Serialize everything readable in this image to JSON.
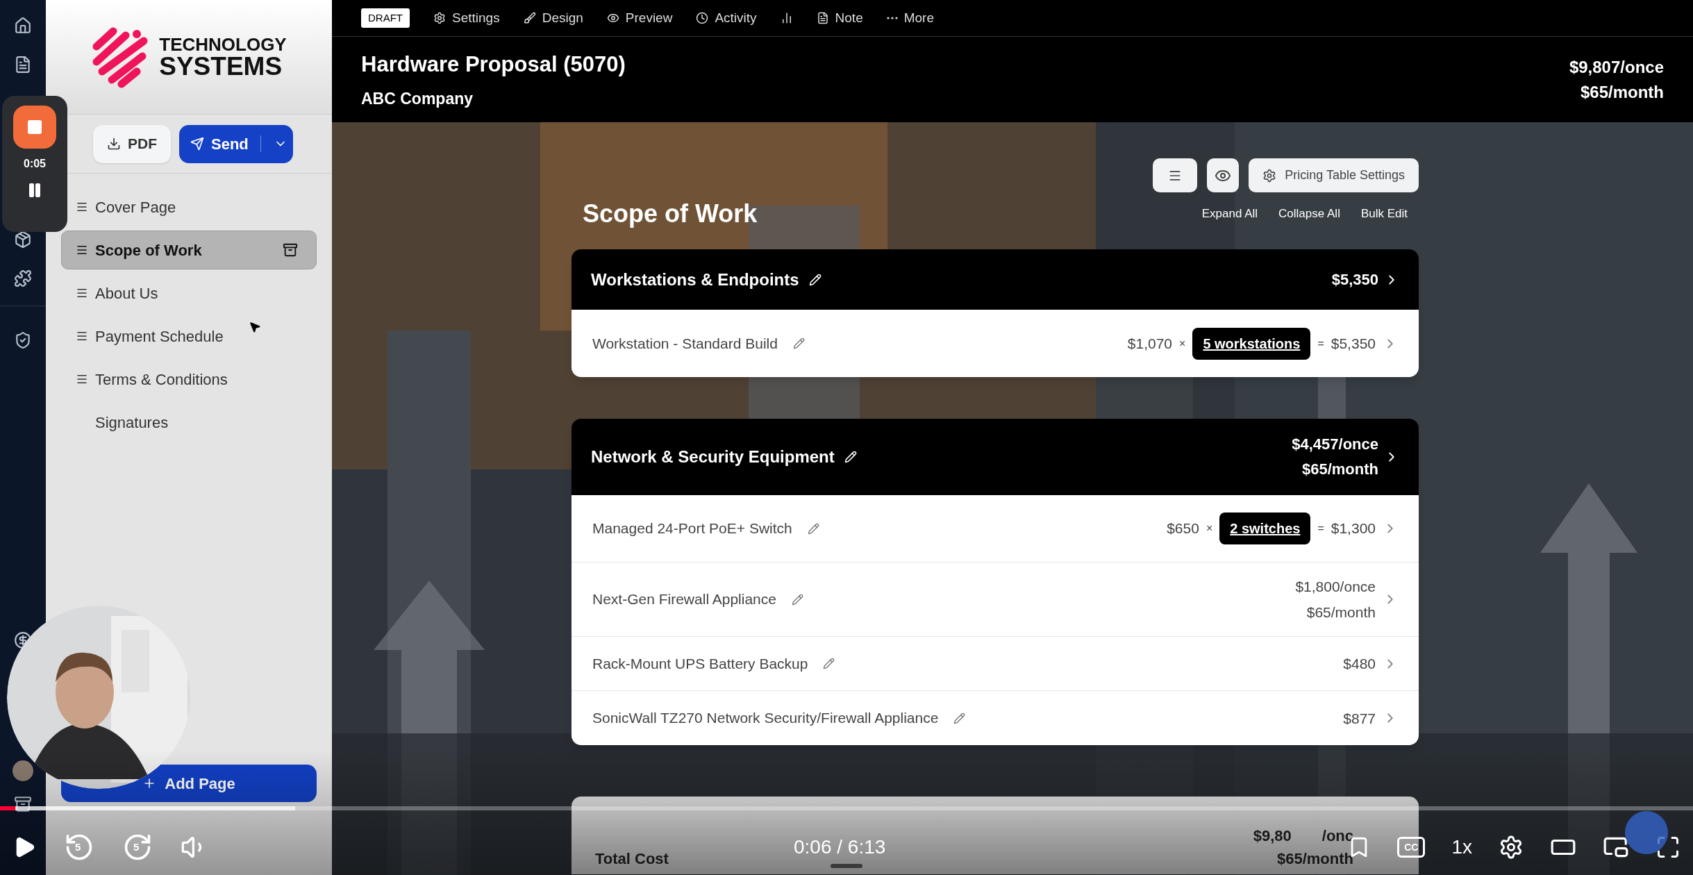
{
  "recorder": {
    "time": "0:05"
  },
  "sidebar": {
    "logo": {
      "line1": "TECHNOLOGY",
      "line2": "SYSTEMS"
    },
    "buttons": [
      {
        "label": "PDF",
        "kind": "download"
      },
      {
        "label": "Send",
        "kind": "send"
      }
    ],
    "pages": [
      {
        "label": "Cover Page",
        "draggable": true,
        "selected": false
      },
      {
        "label": "Scope of Work",
        "draggable": true,
        "selected": true
      },
      {
        "label": "About Us",
        "draggable": true,
        "selected": false
      },
      {
        "label": "Payment Schedule",
        "draggable": true,
        "selected": false
      },
      {
        "label": "Terms & Conditions",
        "draggable": true,
        "selected": false
      },
      {
        "label": "Signatures",
        "draggable": false,
        "selected": false
      }
    ],
    "add_button": "Add Page"
  },
  "toolbar": {
    "status": "DRAFT",
    "items": [
      {
        "kind": "gear",
        "label": "Settings"
      },
      {
        "kind": "brush",
        "label": "Design"
      },
      {
        "kind": "eye",
        "label": "Preview"
      },
      {
        "kind": "clock",
        "label": "Activity"
      },
      {
        "kind": "chart"
      },
      {
        "kind": "note",
        "label": "Note"
      },
      {
        "kind": "dots",
        "label": "More"
      }
    ]
  },
  "header": {
    "title": "Hardware Proposal (5070)",
    "client": "ABC Company",
    "totals": [
      "$9,807/once",
      "$65/month"
    ]
  },
  "scope": {
    "title": "Scope of Work",
    "settings_button": "Pricing Table Settings",
    "links": [
      "Expand All",
      "Collapse All",
      "Bulk Edit"
    ],
    "sections": [
      {
        "name": "Workstations & Endpoints",
        "totals": [
          "$5,350"
        ],
        "items": [
          {
            "kind": "quantity",
            "name": "Workstation - Standard Build",
            "price": "$1,070",
            "times": "×",
            "quantity": "5 workstations",
            "equals": "=",
            "total": "$5,350"
          }
        ]
      },
      {
        "name": "Network & Security Equipment",
        "totals": [
          "$4,457/once",
          "$65/month"
        ],
        "items": [
          {
            "kind": "quantity",
            "name": "Managed 24-Port PoE+ Switch",
            "price": "$650",
            "times": "×",
            "quantity": "2 switches",
            "equals": "=",
            "total": "$1,300"
          },
          {
            "kind": "amounts",
            "name": "Next-Gen Firewall Appliance",
            "amounts": [
              "$1,800/once",
              "$65/month"
            ]
          },
          {
            "kind": "amounts",
            "name": "Rack-Mount UPS Battery Backup",
            "amounts": [
              "$480"
            ]
          },
          {
            "kind": "amounts",
            "name": "SonicWall TZ270 Network Security/Firewall Appliance",
            "amounts": [
              "$877"
            ]
          }
        ]
      }
    ],
    "total": {
      "label": "Total Cost",
      "first_parts": [
        "$9,80",
        "/onc"
      ],
      "second": "$65/month"
    }
  },
  "player": {
    "progress": {
      "level": 0.009
    },
    "rewind": "5",
    "forward": "5",
    "time": "0:06 / 6:13",
    "cc": "CC",
    "speed": "1x"
  }
}
